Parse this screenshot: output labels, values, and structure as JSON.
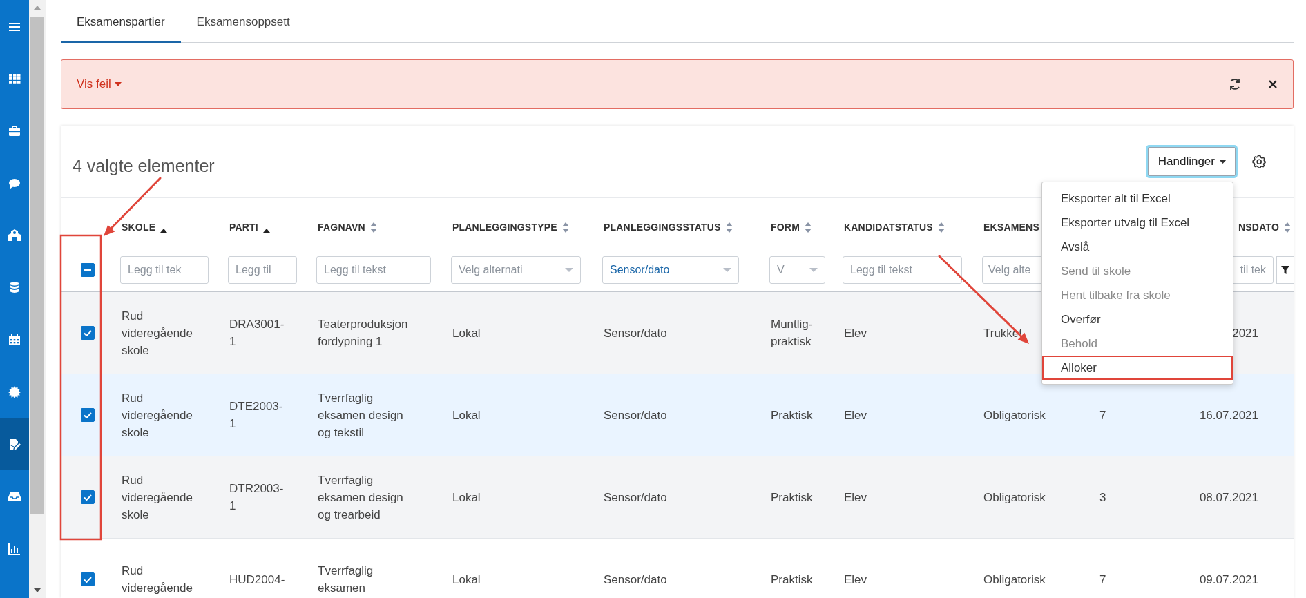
{
  "sidebar": {
    "items": [
      {
        "kind": "menu",
        "selected": false
      },
      {
        "kind": "grid",
        "selected": false
      },
      {
        "kind": "briefcase",
        "selected": false
      },
      {
        "kind": "chat",
        "selected": false
      },
      {
        "kind": "building",
        "selected": false
      },
      {
        "kind": "database",
        "selected": false
      },
      {
        "kind": "calendar",
        "selected": false
      },
      {
        "kind": "badge",
        "selected": false
      },
      {
        "kind": "edit",
        "selected": true
      },
      {
        "kind": "inbox",
        "selected": false
      },
      {
        "kind": "chart",
        "selected": false
      }
    ]
  },
  "tabs": [
    {
      "label": "Eksamenspartier",
      "selected": true
    },
    {
      "label": "Eksamensoppsett",
      "selected": false
    }
  ],
  "banner": {
    "toggle": "Vis feil"
  },
  "panel": {
    "title": "4 valgte elementer",
    "actions": {
      "label": "Handlinger",
      "open": true,
      "items": [
        {
          "label": "Eksporter alt til Excel",
          "disabled": false,
          "annotated": false
        },
        {
          "label": "Eksporter utvalg til Excel",
          "disabled": false,
          "annotated": false
        },
        {
          "label": "Avslå",
          "disabled": false,
          "annotated": false
        },
        {
          "label": "Send til skole",
          "disabled": true,
          "annotated": false
        },
        {
          "label": "Hent tilbake fra skole",
          "disabled": true,
          "annotated": false
        },
        {
          "label": "Overfør",
          "disabled": false,
          "annotated": false
        },
        {
          "label": "Behold",
          "disabled": true,
          "annotated": false
        },
        {
          "label": "Alloker",
          "disabled": false,
          "annotated": true
        }
      ]
    }
  },
  "table": {
    "select_all": {
      "indeterminate": true
    },
    "columns": [
      {
        "label": "SKOLE",
        "sorted": true,
        "filter": {
          "kind": "text",
          "placeholder": "Legg til tek"
        }
      },
      {
        "label": "PARTI",
        "sorted": true,
        "filter": {
          "kind": "text",
          "placeholder": "Legg til"
        }
      },
      {
        "label": "FAGNAVN",
        "sorted": false,
        "filter": {
          "kind": "text",
          "placeholder": "Legg til tekst"
        }
      },
      {
        "label": "PLANLEGGINGSTYPE",
        "sorted": false,
        "filter": {
          "kind": "select",
          "placeholder": "Velg alternati",
          "caret": true
        }
      },
      {
        "label": "PLANLEGGINGSSTATUS",
        "sorted": false,
        "filter": {
          "kind": "select",
          "value": "Sensor/dato",
          "caret": true
        }
      },
      {
        "label": "FORM",
        "sorted": false,
        "filter": {
          "kind": "select",
          "placeholder": "V",
          "caret": true
        }
      },
      {
        "label": "KANDIDATSTATUS",
        "sorted": false,
        "filter": {
          "kind": "text",
          "placeholder": "Legg til tekst"
        }
      },
      {
        "label": "EKSAMENS",
        "filter": {
          "kind": "select",
          "placeholder": "Velg alte"
        }
      },
      {},
      {
        "label": "NSDATO",
        "sorted": false,
        "filter": {
          "kind": "text",
          "placeholder": "til tek",
          "button": true
        }
      }
    ],
    "rows": [
      {
        "selected": true,
        "highlighted": false,
        "cells": [
          "Rud\nvideregående\nskole",
          "DRA3001-\n1",
          "Teaterproduksjon\nfordypning 1",
          "Lokal",
          "Sensor/dato",
          "Muntlig-\npraktisk",
          "Elev",
          "Trukket",
          null,
          "2021"
        ]
      },
      {
        "selected": true,
        "highlighted": true,
        "cells": [
          "Rud\nvideregående\nskole",
          "DTE2003-\n1",
          "Tverrfaglig\neksamen design\nog tekstil",
          "Lokal",
          "Sensor/dato",
          "Praktisk",
          "Elev",
          "Obligatorisk",
          "7",
          "16.07.2021"
        ]
      },
      {
        "selected": true,
        "highlighted": false,
        "cells": [
          "Rud\nvideregående\nskole",
          "DTR2003-\n1",
          "Tverrfaglig\neksamen design\nog trearbeid",
          "Lokal",
          "Sensor/dato",
          "Praktisk",
          "Elev",
          "Obligatorisk",
          "3",
          "08.07.2021"
        ]
      },
      {
        "selected": true,
        "highlighted": false,
        "cells": [
          "Rud\nvideregående",
          "HUD2004-",
          "Tverrfaglig\neksamen",
          "Lokal",
          "Sensor/dato",
          "Praktisk",
          "Elev",
          "Obligatorisk",
          "7",
          "09.07.2021"
        ]
      }
    ]
  },
  "annotations": [
    {
      "kind": "arrow"
    },
    {
      "kind": "frame"
    },
    {
      "kind": "arrow"
    }
  ]
}
